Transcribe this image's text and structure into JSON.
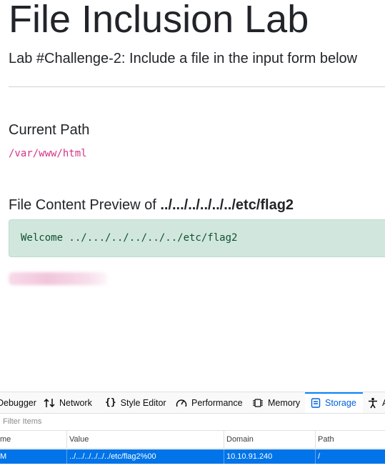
{
  "page": {
    "title": "File Inclusion Lab",
    "subtitle": "Lab #Challenge-2: Include a file in the input form below",
    "current_path_heading": "Current Path",
    "current_path": "/var/www/html",
    "preview_heading_prefix": "File Content Preview of ",
    "preview_heading_file": "../.../../../../../etc/flag2",
    "preview_content": "Welcome ../.../../../../../etc/flag2"
  },
  "devtools": {
    "tabs": [
      {
        "label": "Debugger",
        "icon": "debugger-icon"
      },
      {
        "label": "Network",
        "icon": "network-icon"
      },
      {
        "label": "Style Editor",
        "icon": "style-editor-icon"
      },
      {
        "label": "Performance",
        "icon": "performance-icon"
      },
      {
        "label": "Memory",
        "icon": "memory-icon"
      },
      {
        "label": "Storage",
        "icon": "storage-icon",
        "selected": true
      },
      {
        "label": "A",
        "icon": "accessibility-icon"
      }
    ],
    "filter_placeholder": "Filter Items",
    "columns": [
      "me",
      "Value",
      "Domain",
      "Path"
    ],
    "rows": [
      {
        "name": "M",
        "value": "../.../../../../../etc/flag2%00",
        "domain": "10.10.91.240",
        "path": "/"
      }
    ],
    "accent_color": "#0a84ff",
    "selected_row_color": "#0074e8"
  },
  "colors": {
    "code_pink": "#d63384",
    "alert_bg": "#d1e7dd",
    "alert_text": "#0f5132"
  }
}
